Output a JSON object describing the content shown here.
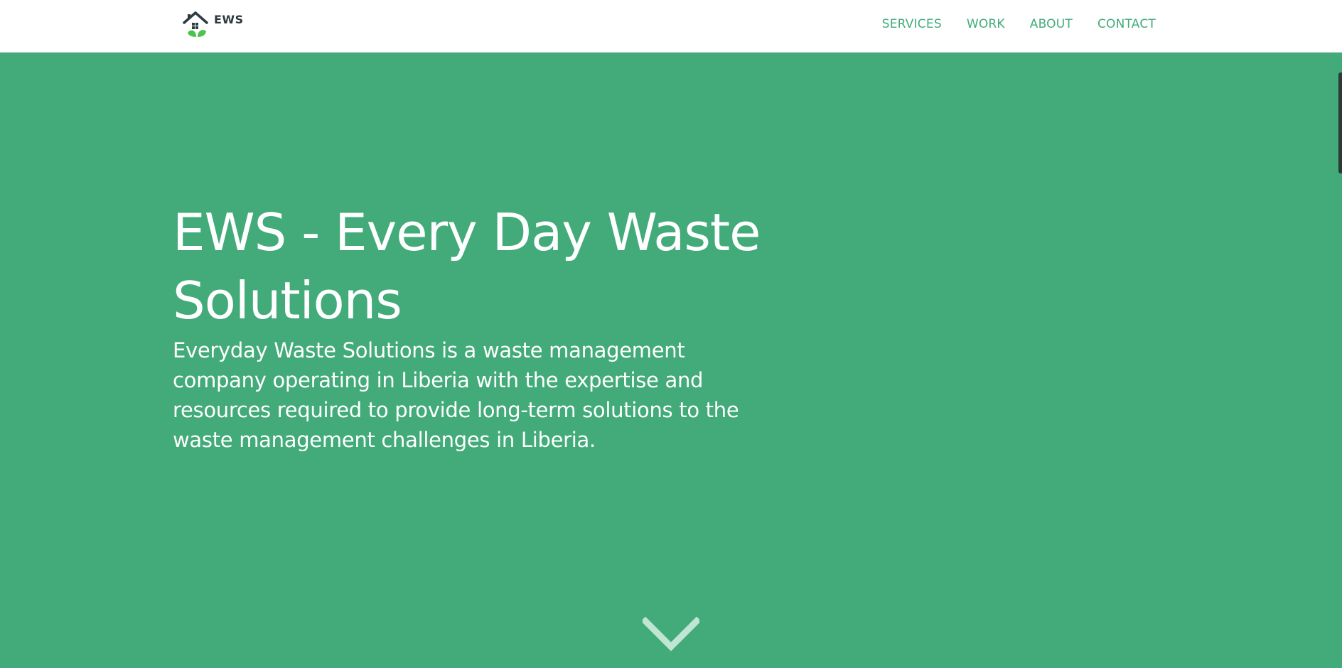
{
  "brand": {
    "logo_text": "EWS",
    "logo_icon": "house-leaf-icon"
  },
  "nav": {
    "items": [
      {
        "label": "SERVICES"
      },
      {
        "label": "WORK"
      },
      {
        "label": "ABOUT"
      },
      {
        "label": "CONTACT"
      }
    ]
  },
  "hero": {
    "title": "EWS - Every Day Waste Solutions",
    "description": "Everyday Waste Solutions is a waste management company operating in Liberia with the expertise and resources required to provide long-term solutions to the waste management challenges in Liberia.",
    "scroll_icon": "chevron-down-icon"
  },
  "colors": {
    "accent": "#42ab79",
    "nav_background": "#ffffff",
    "text_light": "#ffffff",
    "logo_dark": "#2d3a3f",
    "leaf_green": "#4cc34a"
  }
}
